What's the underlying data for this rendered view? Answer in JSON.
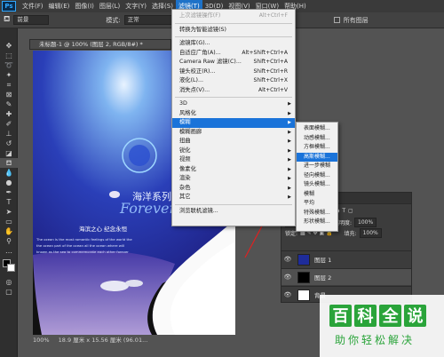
{
  "menubar": {
    "logo": "Ps",
    "items": [
      "文件(F)",
      "编辑(E)",
      "图像(I)",
      "图层(L)",
      "文字(Y)",
      "选择(S)",
      "滤镜(T)",
      "3D(D)",
      "视图(V)",
      "窗口(W)",
      "帮助(H)"
    ],
    "active_index": 6
  },
  "options": {
    "brush_label": "前景",
    "mode_label": "模式:",
    "mode_value": "正常",
    "opacity_label": "不透",
    "all_layers_label": "所有图层"
  },
  "document": {
    "tab_title": "未标题-1 @ 100% (图层 2, RGB/8#) *",
    "zoom": "100%",
    "size_info": "18.9 厘米 x 15.56 厘米 (96.01..."
  },
  "artwork": {
    "title_cn": "海洋系列",
    "title_en": "Forever",
    "subtitle": "海滨之心  纪念永恒",
    "lines": [
      "The ocean is the most romantic feelings of the world the",
      "the ocean part of the ocean all the ocean where will",
      "known as the sea to commemorate each other forever"
    ]
  },
  "filter_menu": {
    "items": [
      {
        "label": "上次滤镜操作(F)",
        "shortcut": "Alt+Ctrl+F",
        "disabled": true
      },
      {
        "sep": true
      },
      {
        "label": "转换为智能滤镜(S)"
      },
      {
        "sep": true
      },
      {
        "label": "滤镜库(G)..."
      },
      {
        "label": "自适应广角(A)...",
        "shortcut": "Alt+Shift+Ctrl+A"
      },
      {
        "label": "Camera Raw 滤镜(C)...",
        "shortcut": "Shift+Ctrl+A"
      },
      {
        "label": "镜头校正(R)...",
        "shortcut": "Shift+Ctrl+R"
      },
      {
        "label": "液化(L)...",
        "shortcut": "Shift+Ctrl+X"
      },
      {
        "label": "消失点(V)...",
        "shortcut": "Alt+Ctrl+V"
      },
      {
        "sep": true
      },
      {
        "label": "3D",
        "submenu": true
      },
      {
        "label": "风格化",
        "submenu": true
      },
      {
        "label": "模糊",
        "submenu": true,
        "highlight": true
      },
      {
        "label": "模糊画廊",
        "submenu": true
      },
      {
        "label": "扭曲",
        "submenu": true
      },
      {
        "label": "锐化",
        "submenu": true
      },
      {
        "label": "视频",
        "submenu": true
      },
      {
        "label": "像素化",
        "submenu": true
      },
      {
        "label": "渲染",
        "submenu": true
      },
      {
        "label": "杂色",
        "submenu": true
      },
      {
        "label": "其它",
        "submenu": true
      },
      {
        "sep": true
      },
      {
        "label": "浏览联机滤镜..."
      }
    ]
  },
  "blur_menu": {
    "items": [
      "表面模糊...",
      "动感模糊...",
      "方框模糊...",
      "高斯模糊...",
      "进一步模糊",
      "径向模糊...",
      "镜头模糊...",
      "模糊",
      "平均",
      "特殊模糊...",
      "形状模糊..."
    ],
    "highlight_index": 3
  },
  "layers": {
    "mode": "正常",
    "opacity_label": "不透明度:",
    "opacity_value": "100%",
    "lock_label": "锁定:",
    "fill_label": "填充:",
    "fill_value": "100%",
    "items": [
      {
        "name": "图层 1"
      },
      {
        "name": "图层 2"
      },
      {
        "name": "背景"
      }
    ]
  },
  "watermark": {
    "chars": [
      "百",
      "科",
      "全",
      "说"
    ],
    "subtitle": "助你轻松解决"
  }
}
